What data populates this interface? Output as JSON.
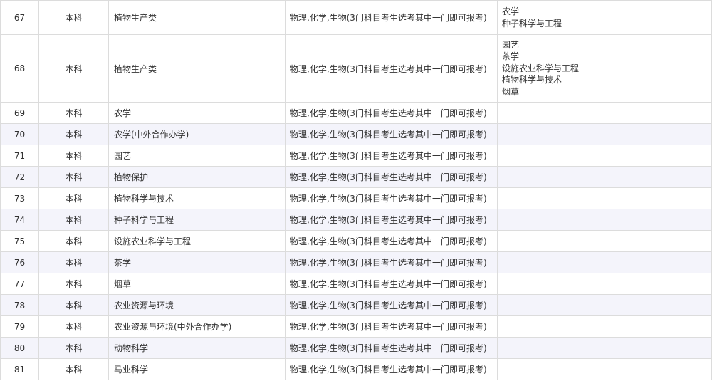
{
  "rows": [
    {
      "no": "67",
      "level": "本科",
      "major": "植物生产类",
      "subjects": "物理,化学,生物(3门科目考生选考其中一门即可报考)",
      "included": [
        "农学",
        "种子科学与工程"
      ]
    },
    {
      "no": "68",
      "level": "本科",
      "major": "植物生产类",
      "subjects": "物理,化学,生物(3门科目考生选考其中一门即可报考)",
      "included": [
        "园艺",
        "茶学",
        "设施农业科学与工程",
        "植物科学与技术",
        "烟草"
      ]
    },
    {
      "no": "69",
      "level": "本科",
      "major": "农学",
      "subjects": "物理,化学,生物(3门科目考生选考其中一门即可报考)",
      "included": []
    },
    {
      "no": "70",
      "level": "本科",
      "major": "农学(中外合作办学)",
      "subjects": "物理,化学,生物(3门科目考生选考其中一门即可报考)",
      "included": []
    },
    {
      "no": "71",
      "level": "本科",
      "major": "园艺",
      "subjects": "物理,化学,生物(3门科目考生选考其中一门即可报考)",
      "included": []
    },
    {
      "no": "72",
      "level": "本科",
      "major": "植物保护",
      "subjects": "物理,化学,生物(3门科目考生选考其中一门即可报考)",
      "included": []
    },
    {
      "no": "73",
      "level": "本科",
      "major": "植物科学与技术",
      "subjects": "物理,化学,生物(3门科目考生选考其中一门即可报考)",
      "included": []
    },
    {
      "no": "74",
      "level": "本科",
      "major": "种子科学与工程",
      "subjects": "物理,化学,生物(3门科目考生选考其中一门即可报考)",
      "included": []
    },
    {
      "no": "75",
      "level": "本科",
      "major": "设施农业科学与工程",
      "subjects": "物理,化学,生物(3门科目考生选考其中一门即可报考)",
      "included": []
    },
    {
      "no": "76",
      "level": "本科",
      "major": "茶学",
      "subjects": "物理,化学,生物(3门科目考生选考其中一门即可报考)",
      "included": []
    },
    {
      "no": "77",
      "level": "本科",
      "major": "烟草",
      "subjects": "物理,化学,生物(3门科目考生选考其中一门即可报考)",
      "included": []
    },
    {
      "no": "78",
      "level": "本科",
      "major": "农业资源与环境",
      "subjects": "物理,化学,生物(3门科目考生选考其中一门即可报考)",
      "included": []
    },
    {
      "no": "79",
      "level": "本科",
      "major": "农业资源与环境(中外合作办学)",
      "subjects": "物理,化学,生物(3门科目考生选考其中一门即可报考)",
      "included": []
    },
    {
      "no": "80",
      "level": "本科",
      "major": "动物科学",
      "subjects": "物理,化学,生物(3门科目考生选考其中一门即可报考)",
      "included": []
    },
    {
      "no": "81",
      "level": "本科",
      "major": "马业科学",
      "subjects": "物理,化学,生物(3门科目考生选考其中一门即可报考)",
      "included": []
    }
  ]
}
